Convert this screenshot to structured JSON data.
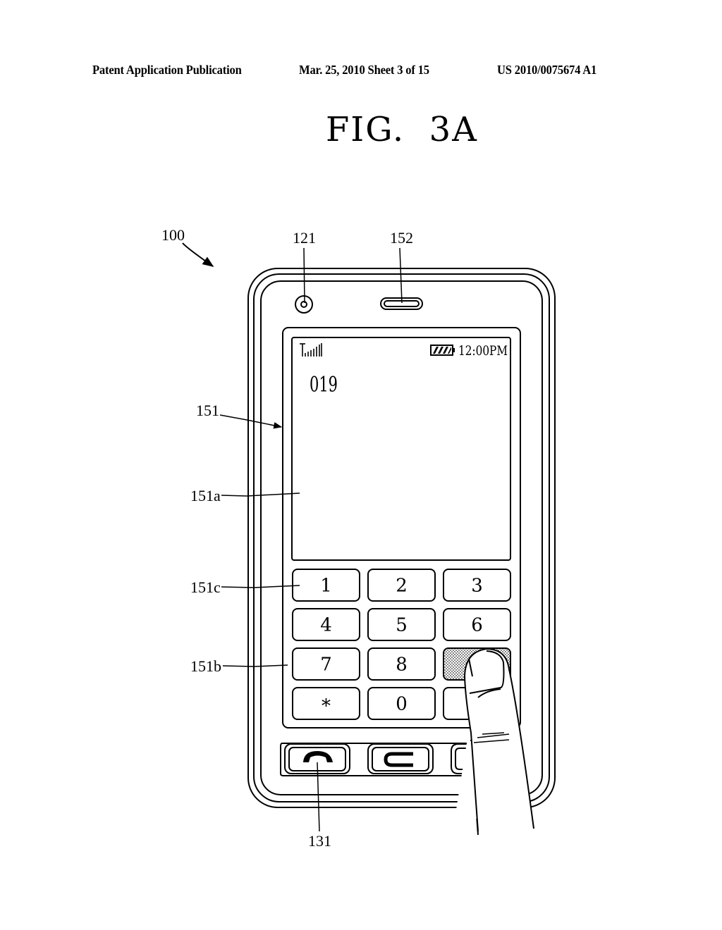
{
  "header": {
    "left": "Patent Application Publication",
    "middle": "Mar. 25, 2010  Sheet 3 of 15",
    "right": "US 2010/0075674 A1"
  },
  "figure": {
    "title": "FIG.  3A"
  },
  "reference_numerals": {
    "device": "100",
    "camera": "121",
    "speaker": "152",
    "display": "151",
    "output_region": "151a",
    "input_region": "151b",
    "key_button": "151c",
    "call_button": "131"
  },
  "phone_screen": {
    "status_bar": {
      "signal_icon": "signal-strength-icon",
      "battery_icon": "battery-icon",
      "time": "12:00PM"
    },
    "dialed_number": "019"
  },
  "keypad": {
    "keys": [
      "1",
      "2",
      "3",
      "4",
      "5",
      "6",
      "7",
      "8",
      "",
      "*",
      "0",
      ""
    ],
    "touched_key_index": 8
  },
  "hardware_buttons": [
    {
      "icon": "call-handset-icon"
    },
    {
      "icon": "clear-c-icon"
    },
    {
      "icon": "end-button-icon"
    }
  ]
}
